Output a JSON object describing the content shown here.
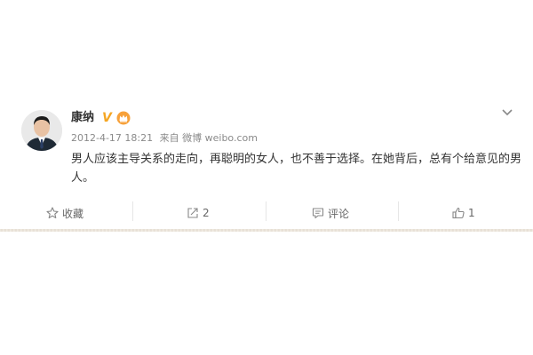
{
  "post": {
    "username": "康纳",
    "verified_badge": "V",
    "crown_icon": "crown-icon",
    "timestamp": "2012-4-17 18:21",
    "source_prefix": "来自",
    "source": "微博 weibo.com",
    "text": "男人应该主导关系的走向，再聪明的女人，也不善于选择。在她背后，总有个给意见的男人。"
  },
  "actions": {
    "favorite_label": "收藏",
    "repost_count": "2",
    "comment_label": "评论",
    "like_count": "1"
  },
  "colors": {
    "badge": "#f5a623",
    "meta_text": "#8a8a8a",
    "body_text": "#333333"
  }
}
